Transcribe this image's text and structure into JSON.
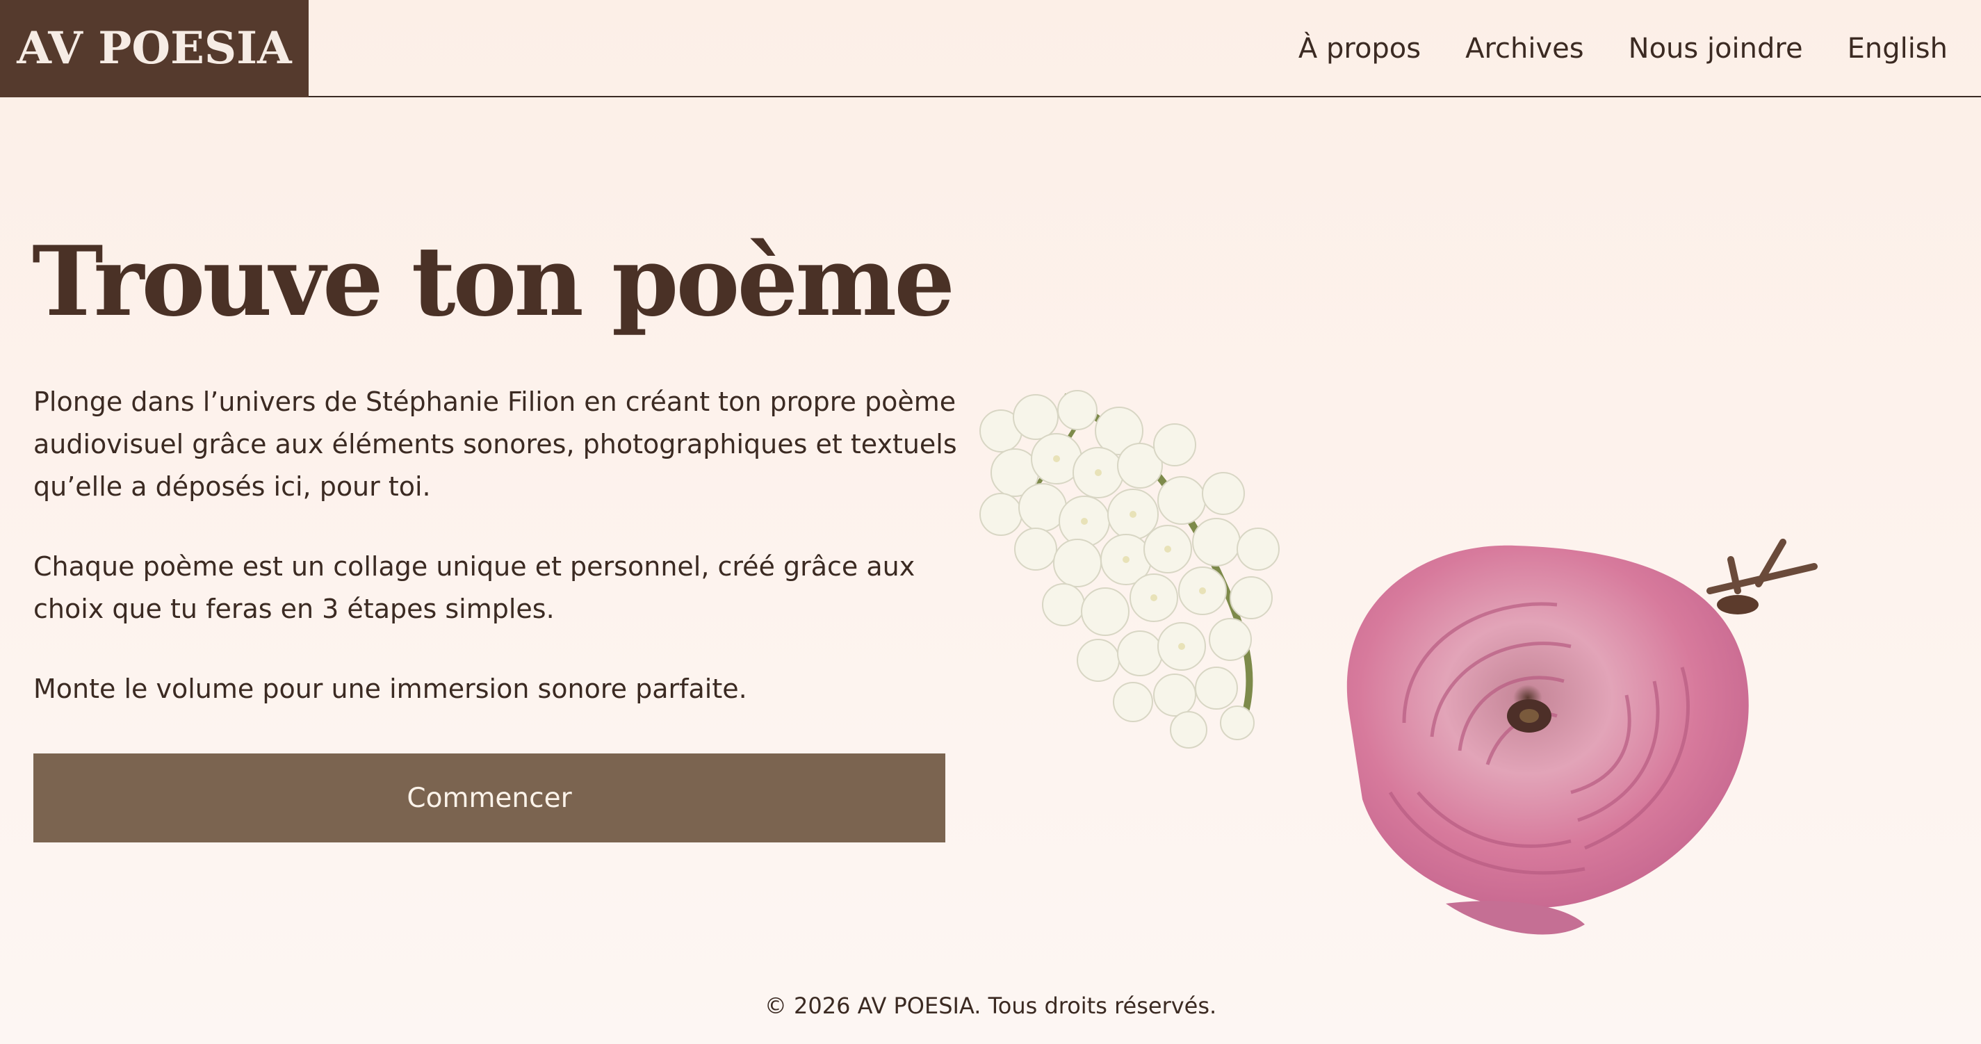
{
  "header": {
    "logo": "AV POESIA",
    "nav": [
      "À propos",
      "Archives",
      "Nous joindre",
      "English"
    ]
  },
  "hero": {
    "title": "Trouve ton poème",
    "paragraphs": [
      "Plonge dans l’univers de Stéphanie Filion en créant ton propre poème audiovisuel grâce aux éléments sonores, photographiques et textuels qu’elle a déposés ici, pour toi.",
      "Chaque poème est un collage unique et personnel, créé grâce aux choix que tu feras en 3 étapes simples.",
      "Monte le volume pour une immersion sonore parfaite."
    ],
    "cta": "Commencer"
  },
  "art": {
    "items": [
      "lilac-flower-image",
      "pink-ranunculus-image"
    ]
  },
  "footer": {
    "copyright": "© 2026 AV POESIA. Tous droits réservés."
  },
  "colors": {
    "brand": "#553a2d",
    "button": "#7b6450",
    "background": "#fcefe7"
  }
}
